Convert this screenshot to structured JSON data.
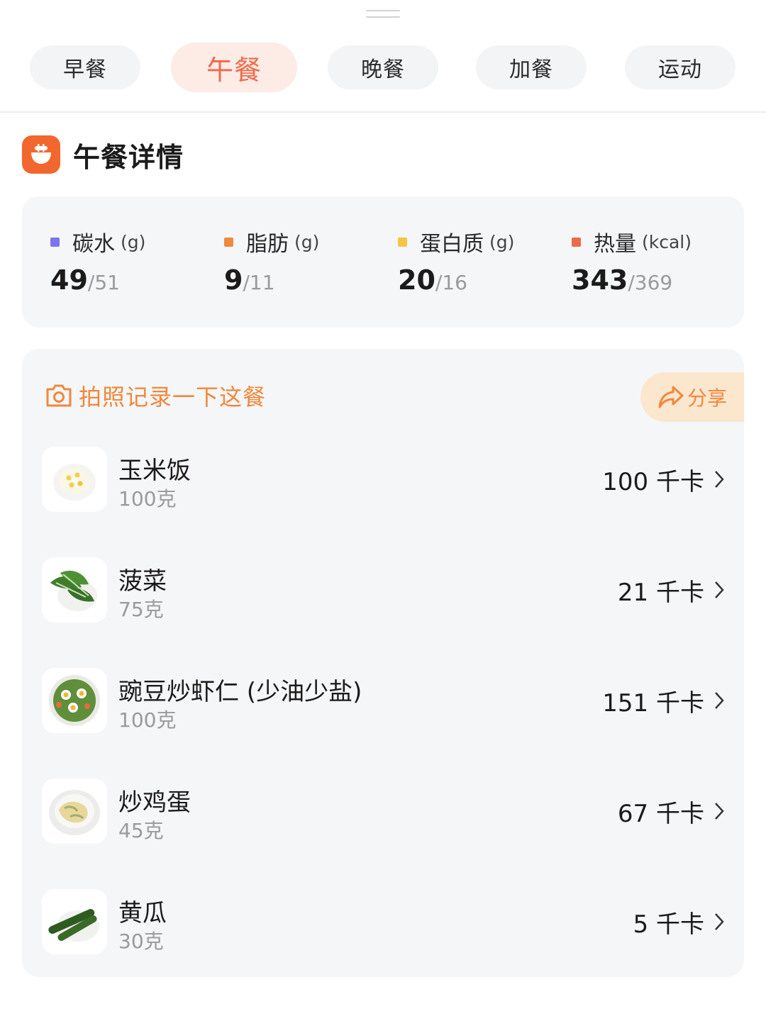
{
  "tabs": [
    {
      "label": "早餐"
    },
    {
      "label": "午餐",
      "active": true
    },
    {
      "label": "晚餐"
    },
    {
      "label": "加餐"
    },
    {
      "label": "运动"
    }
  ],
  "section": {
    "title": "午餐详情",
    "icon": "meal-bowl-icon"
  },
  "nutrients": [
    {
      "name": "碳水",
      "unit": "(g)",
      "current": "49",
      "goal": "/51",
      "color": "#7b74ef"
    },
    {
      "name": "脂肪",
      "unit": "(g)",
      "current": "9",
      "goal": "/11",
      "color": "#f08a3e"
    },
    {
      "name": "蛋白质",
      "unit": "(g)",
      "current": "20",
      "goal": "/16",
      "color": "#f5c543"
    },
    {
      "name": "热量",
      "unit": "(kcal)",
      "current": "343",
      "goal": "/369",
      "color": "#ef6a4a"
    }
  ],
  "foods_card": {
    "photo_prompt": "拍照记录一下这餐",
    "share_label": "分享",
    "items": [
      {
        "name": "玉米饭",
        "amount": "100克",
        "kcal": "100 千卡",
        "icon": "corn-rice-icon"
      },
      {
        "name": "菠菜",
        "amount": "75克",
        "kcal": "21 千卡",
        "icon": "spinach-icon"
      },
      {
        "name": "豌豆炒虾仁 (少油少盐)",
        "amount": "100克",
        "kcal": "151 千卡",
        "icon": "peas-shrimp-icon"
      },
      {
        "name": "炒鸡蛋",
        "amount": "45克",
        "kcal": "67 千卡",
        "icon": "scrambled-egg-icon"
      },
      {
        "name": "黄瓜",
        "amount": "30克",
        "kcal": "5 千卡",
        "icon": "cucumber-icon"
      }
    ]
  },
  "colors": {
    "accent": "#ef6a4a",
    "orange": "#f0883c",
    "card_bg": "#f5f6f8"
  }
}
